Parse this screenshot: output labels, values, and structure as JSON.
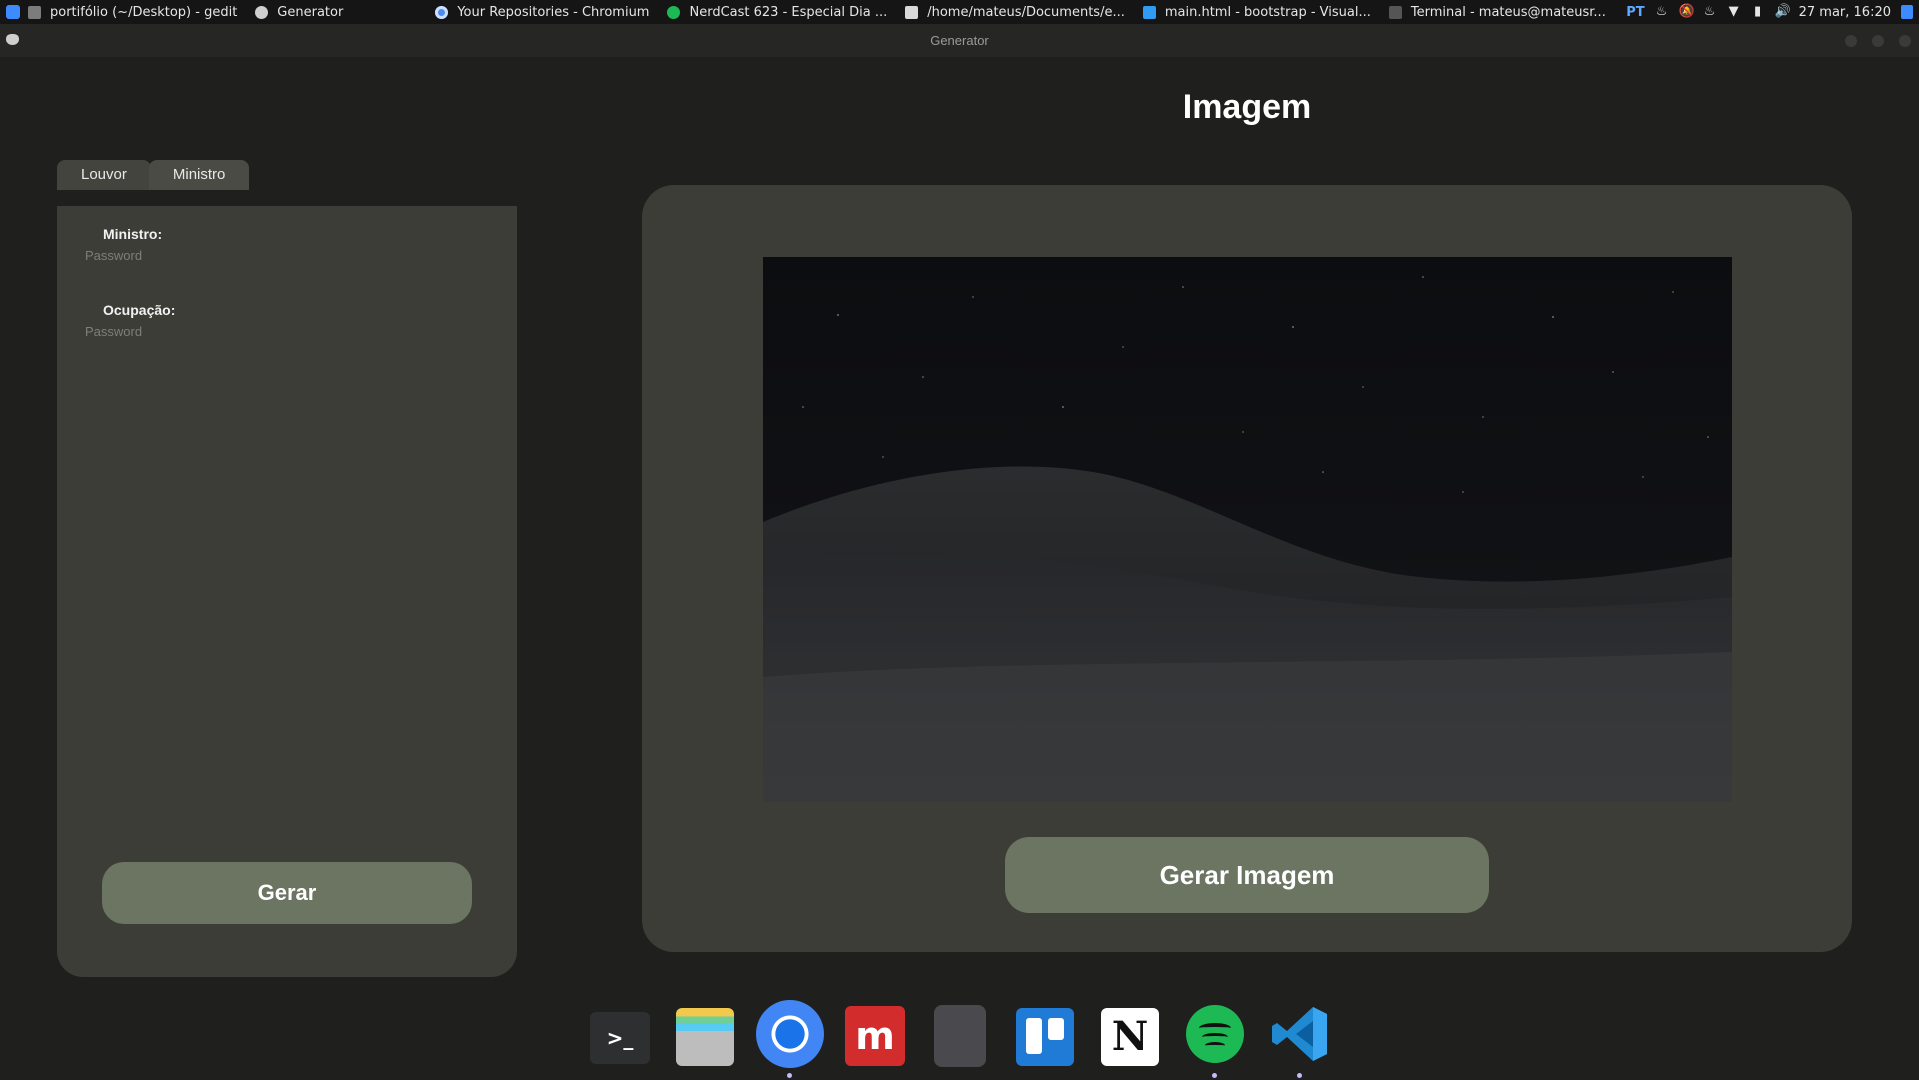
{
  "taskbar": {
    "tasks": [
      {
        "label": "portifólio (~/Desktop) - gedit",
        "icon": "gedit-icon"
      },
      {
        "label": "Generator",
        "icon": "generator-icon"
      },
      {
        "label": "Your Repositories - Chromium",
        "icon": "chromium-icon"
      },
      {
        "label": "NerdCast 623 - Especial Dia ...",
        "icon": "spotify-icon"
      },
      {
        "label": "/home/mateus/Documents/e...",
        "icon": "folder-icon"
      },
      {
        "label": "main.html - bootstrap - Visual...",
        "icon": "vscode-icon"
      },
      {
        "label": "Terminal - mateus@mateusr...",
        "icon": "terminal-icon"
      }
    ],
    "tray": {
      "language": "PT",
      "clock": "27 mar, 16:20"
    }
  },
  "window": {
    "title": "Generator"
  },
  "left": {
    "tabs": [
      {
        "label": "Louvor"
      },
      {
        "label": "Ministro"
      }
    ],
    "fields": [
      {
        "label": "Ministro:",
        "placeholder": "Password",
        "value": ""
      },
      {
        "label": "Ocupação:",
        "placeholder": "Password",
        "value": ""
      }
    ],
    "button_label": "Gerar"
  },
  "right": {
    "heading": "Imagem",
    "image_description_icon": "night-field-image",
    "button_label": "Gerar Imagem"
  },
  "dock": {
    "items": [
      {
        "name": "terminal-app-icon",
        "running": false
      },
      {
        "name": "files-app-icon",
        "running": false
      },
      {
        "name": "chromium-app-icon",
        "running": true
      },
      {
        "name": "mega-app-icon",
        "running": false
      },
      {
        "name": "ebook-app-icon",
        "running": false
      },
      {
        "name": "trello-app-icon",
        "running": false
      },
      {
        "name": "notion-app-icon",
        "running": false
      },
      {
        "name": "spotify-app-icon",
        "running": true
      },
      {
        "name": "vscode-app-icon",
        "running": true
      }
    ]
  },
  "colors": {
    "background": "#1f201d",
    "panel": "#3c3d37",
    "button": "#6b7562",
    "accent_blue": "#3d8bff"
  }
}
